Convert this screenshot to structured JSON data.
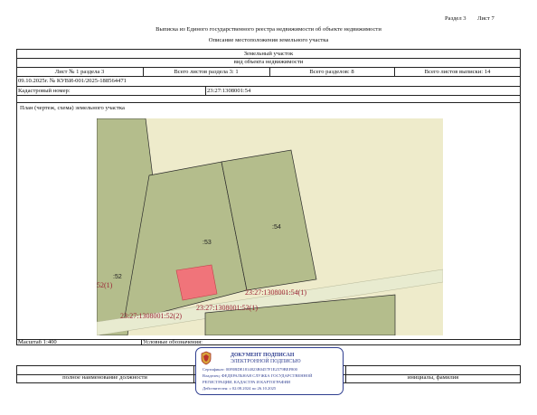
{
  "header": {
    "section": "Раздел 3",
    "sheet": "Лист 7",
    "title": "Выписка из Единого государственного реестра недвижимости об объекте недвижимости",
    "subtitle": "Описание местоположения земельного участка"
  },
  "table": {
    "object_type": "Земельный участок",
    "object_type_caption": "вид объекта недвижимости",
    "sheet_of_section": "Лист № 1 раздела 3",
    "sheets_in_section": "Всего листов раздела 3: 1",
    "sections_total": "Всего разделов: 8",
    "sheets_total": "Всего листов выписки: 14",
    "doc_number": "09.10.2025г. № КУВИ-001/2025-188564471",
    "cadastral_label": "Кадастровый номер:",
    "cadastral_value": "23:27:1308001:54",
    "plan_caption": "План (чертеж, схема) земельного участка",
    "scale_label": "Масштаб 1:400",
    "legend_label": "Условные обозначения:",
    "sign_left": "полное наименование должности",
    "sign_right": "инициалы, фамилия"
  },
  "map": {
    "parcel_labels": [
      ":53",
      ":54",
      ":52"
    ],
    "cadastral_labels": [
      "23:27:1308001:54(1)",
      "23:27:1308001:53(1)",
      "23:27:1308001:52(2)"
    ],
    "edge_label": "52(1)",
    "colors": {
      "background": "#eeebcb",
      "parcel_fill": "#b4bd8c",
      "parcel_stroke": "#2b2b2b",
      "highlight": "#f0747a",
      "label_red": "#9b2234"
    }
  },
  "stamp": {
    "line1": "ДОКУМЕНТ ПОДПИСАН",
    "line2": "ЭЛЕКТРОННОЙ ПОДПИСЬЮ",
    "certificate": "Сертификат: 00F0BDE1814823B0457F1E2579BEF800",
    "owner1": "Владелец: ФЕДЕРАЛЬНАЯ СЛУЖБА ГОСУДАРСТВЕННОЙ",
    "owner2": "РЕГИСТРАЦИИ, КАДАСТРА И КАРТОГРАФИИ",
    "valid": "Действителен: с 02.08.2024 по 26.10.2025",
    "emblem_icon": "eagle-emblem-icon",
    "color": "#2e3d8f"
  }
}
